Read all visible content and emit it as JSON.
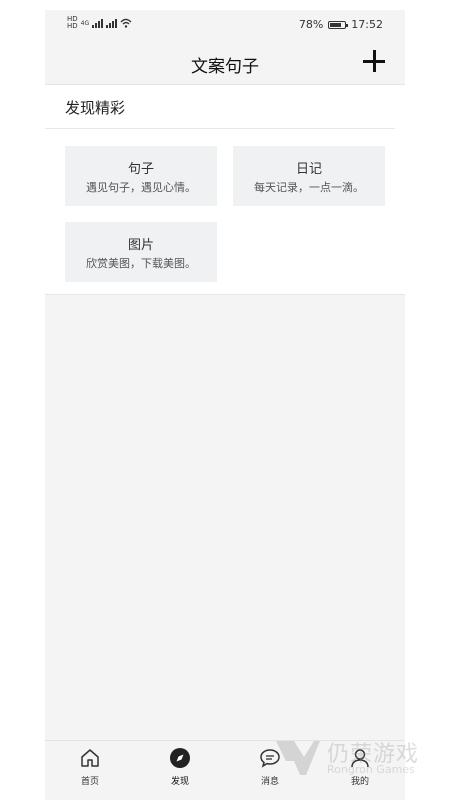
{
  "status": {
    "sim1": [
      "HD",
      "B"
    ],
    "sim2": [
      "HD",
      "B"
    ],
    "network": "4G",
    "battery_level": 0.78,
    "battery_text": "78%",
    "time": "17:52"
  },
  "header": {
    "title": "文案句子",
    "add_icon": "plus-icon"
  },
  "section": {
    "title": "发现精彩"
  },
  "cards": [
    {
      "title": "句子",
      "subtitle": "遇见句子，遇见心情。"
    },
    {
      "title": "日记",
      "subtitle": "每天记录，一点一滴。"
    },
    {
      "title": "图片",
      "subtitle": "欣赏美图，下载美图。"
    }
  ],
  "tabs": [
    {
      "label": "首页",
      "icon": "home-icon"
    },
    {
      "label": "发现",
      "icon": "compass-icon",
      "active": true
    },
    {
      "label": "消息",
      "icon": "chat-icon"
    },
    {
      "label": "我的",
      "icon": "user-icon"
    }
  ],
  "watermark": {
    "zh": "仍荣游戏",
    "en": "Rongron Games"
  }
}
